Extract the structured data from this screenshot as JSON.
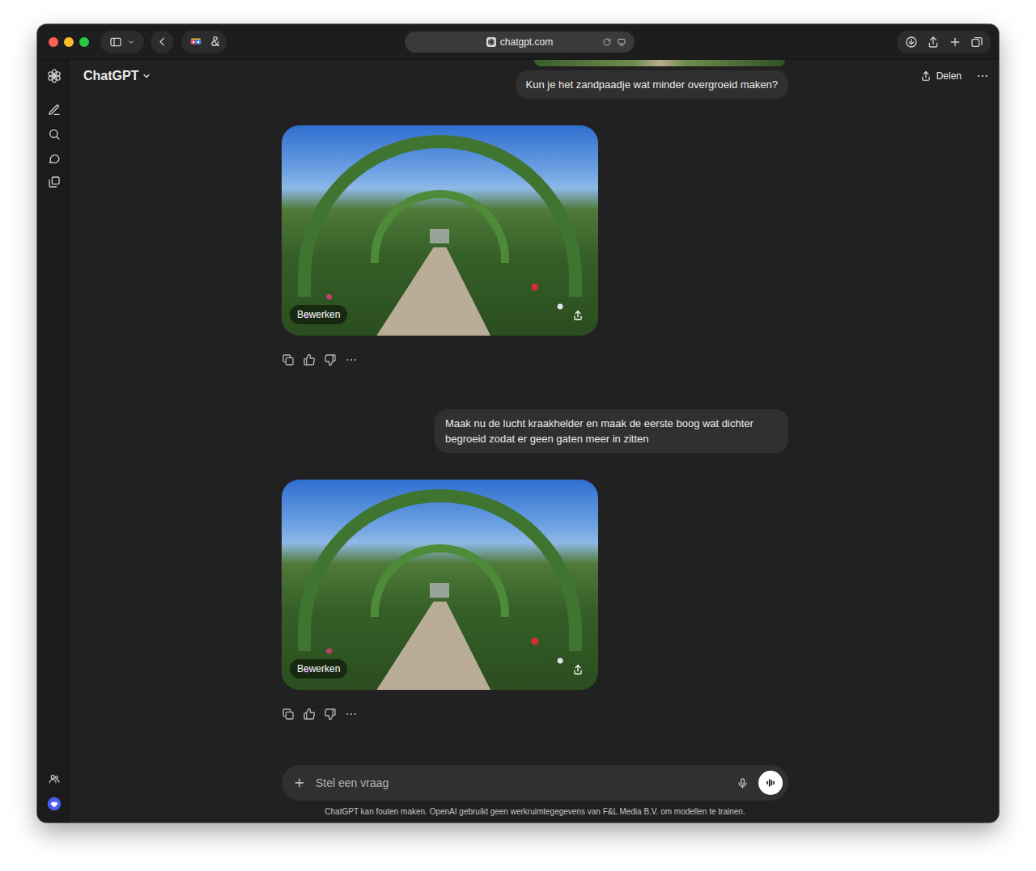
{
  "browser": {
    "url": "chatgpt.com",
    "extension_label": "&"
  },
  "header": {
    "title": "ChatGPT",
    "share": "Delen"
  },
  "messages": [
    {
      "kind": "image-peek"
    },
    {
      "kind": "user",
      "text": "Kun je het zandpaadje wat minder overgroeid maken?"
    },
    {
      "kind": "image",
      "edit": "Bewerken"
    },
    {
      "kind": "user",
      "text": "Maak nu de lucht kraakhelder en maak de eerste boog wat dichter begroeid zodat er geen gaten meer in zitten"
    },
    {
      "kind": "image",
      "edit": "Bewerken"
    }
  ],
  "composer": {
    "placeholder": "Stel een vraag"
  },
  "disclaimer": "ChatGPT kan fouten maken. OpenAI gebruikt geen werkruimtegegevens van F&L Media B.V. om modellen te trainen."
}
